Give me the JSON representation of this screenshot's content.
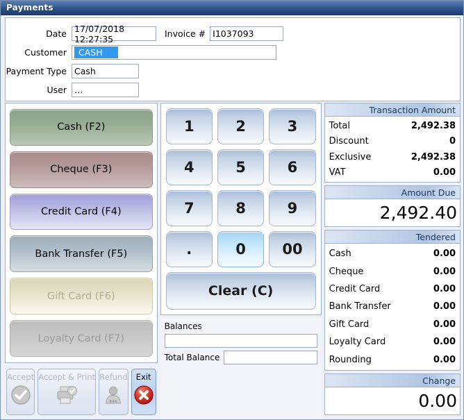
{
  "window": {
    "title": "Payments"
  },
  "form": {
    "date_label": "Date",
    "date_value": "17/07/2018 12:27:35",
    "invoice_label": "Invoice #",
    "invoice_value": "I1037093",
    "customer_label": "Customer",
    "customer_value": "CASH",
    "payment_type_label": "Payment Type",
    "payment_type_value": "Cash",
    "user_label": "User",
    "user_value": "…"
  },
  "payment_buttons": [
    {
      "label": "Cash (F2)",
      "enabled": true
    },
    {
      "label": "Cheque (F3)",
      "enabled": true
    },
    {
      "label": "Credit Card (F4)",
      "enabled": true
    },
    {
      "label": "Bank Transfer (F5)",
      "enabled": true
    },
    {
      "label": "Gift Card (F6)",
      "enabled": false
    },
    {
      "label": "Loyalty Card (F7)",
      "enabled": false
    }
  ],
  "keypad": {
    "keys": [
      "1",
      "2",
      "3",
      "4",
      "5",
      "6",
      "7",
      "8",
      "9",
      ".",
      "0",
      "00"
    ],
    "active_key": "0",
    "clear_label": "Clear (C)"
  },
  "balances": {
    "balances_label": "Balances",
    "balances_value": "",
    "total_balance_label": "Total Balance",
    "total_balance_value": ""
  },
  "transaction": {
    "header": "Transaction Amount",
    "rows": [
      {
        "label": "Total",
        "value": "2,492.38"
      },
      {
        "label": "Discount",
        "value": "0"
      },
      {
        "label": "Exclusive",
        "value": "2,492.38"
      },
      {
        "label": "VAT",
        "value": "0.00"
      }
    ]
  },
  "amount_due": {
    "header": "Amount Due",
    "value": "2,492.40"
  },
  "tendered": {
    "header": "Tendered",
    "rows": [
      {
        "label": "Cash",
        "value": "0.00"
      },
      {
        "label": "Cheque",
        "value": "0.00"
      },
      {
        "label": "Credit Card",
        "value": "0.00"
      },
      {
        "label": "Bank Transfer",
        "value": "0.00"
      },
      {
        "label": "Gift Card",
        "value": "0.00"
      },
      {
        "label": "Loyalty Card",
        "value": "0.00"
      },
      {
        "label": "Rounding",
        "value": "0.00"
      }
    ]
  },
  "change": {
    "header": "Change",
    "value": "0.00"
  },
  "actions": [
    {
      "label": "Accept",
      "icon": "check-circle-icon",
      "enabled": false
    },
    {
      "label": "Accept & Print",
      "icon": "printer-check-icon",
      "enabled": false
    },
    {
      "label": "Refund",
      "icon": "person-icon",
      "enabled": false
    },
    {
      "label": "Exit",
      "icon": "red-x-circle-icon",
      "enabled": true
    }
  ],
  "colors": {
    "titlebar": "#2c4f86",
    "accent": "#3399ee",
    "exit_red": "#cc2b26"
  }
}
